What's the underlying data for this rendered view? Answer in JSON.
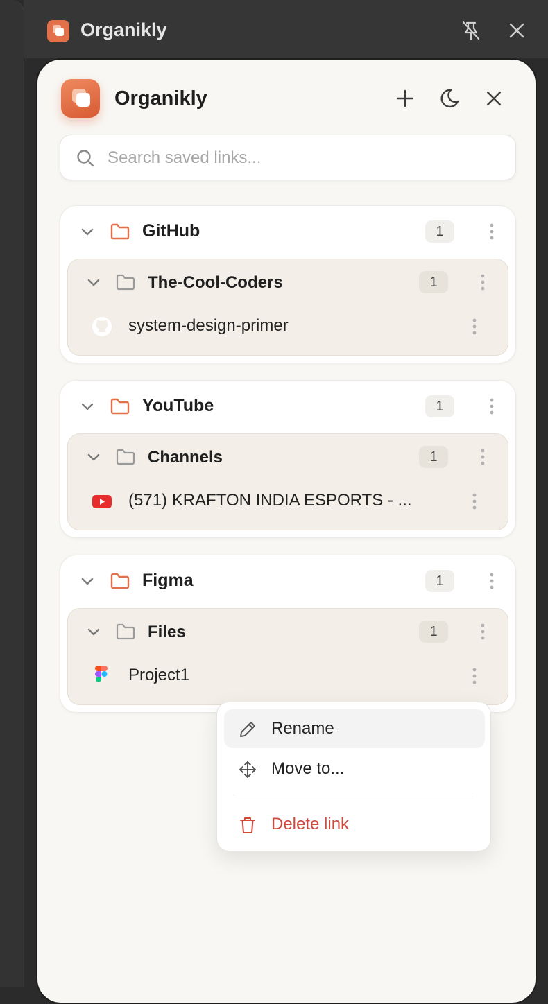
{
  "window": {
    "title": "Organikly"
  },
  "header": {
    "title": "Organikly"
  },
  "search": {
    "placeholder": "Search saved links..."
  },
  "folders": [
    {
      "name": "GitHub",
      "count": "1",
      "subfolder": {
        "name": "The-Cool-Coders",
        "count": "1",
        "link": {
          "title": "system-design-primer",
          "icon": "github-icon"
        }
      }
    },
    {
      "name": "YouTube",
      "count": "1",
      "subfolder": {
        "name": "Channels",
        "count": "1",
        "link": {
          "title": "(571) KRAFTON INDIA ESPORTS - ...",
          "icon": "youtube-icon"
        }
      }
    },
    {
      "name": "Figma",
      "count": "1",
      "subfolder": {
        "name": "Files",
        "count": "1",
        "link": {
          "title": "Project1",
          "icon": "figma-icon"
        }
      }
    }
  ],
  "context_menu": {
    "items": [
      {
        "label": "Rename",
        "icon": "pencil-icon"
      },
      {
        "label": "Move to...",
        "icon": "move-icon"
      },
      {
        "label": "Delete link",
        "icon": "trash-icon"
      }
    ]
  },
  "colors": {
    "accent": "#e2704a",
    "danger": "#d04a3c",
    "panel_bg": "#f8f7f4",
    "subfolder_bg": "#f3efe8",
    "youtube_red": "#e62c2c"
  }
}
